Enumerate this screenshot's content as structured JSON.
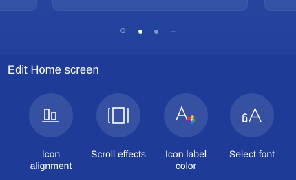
{
  "page_indicator": {
    "items": [
      {
        "type": "home",
        "glyph": "G"
      },
      {
        "type": "dot",
        "active": true
      },
      {
        "type": "dot",
        "active": false
      },
      {
        "type": "add",
        "glyph": "+"
      }
    ]
  },
  "edit_panel": {
    "title": "Edit Home screen",
    "options": [
      {
        "label": "Icon\nalignment",
        "icon": "icon-alignment-icon"
      },
      {
        "label": "Scroll effects",
        "icon": "scroll-effects-icon"
      },
      {
        "label": "Icon label\ncolor",
        "icon": "icon-label-color-icon"
      },
      {
        "label": "Select font",
        "icon": "select-font-icon"
      }
    ]
  },
  "colors": {
    "background": "#1e3c97",
    "option_circle": "rgba(255,255,255,0.11)",
    "text": "#ffffff"
  }
}
